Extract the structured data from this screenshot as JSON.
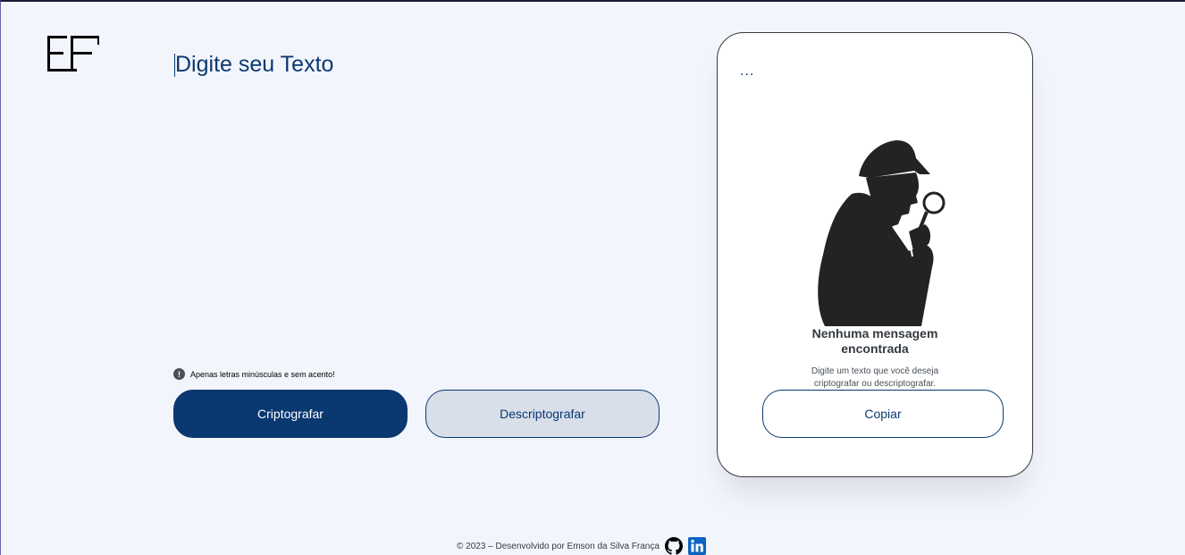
{
  "logo": {
    "alt": "EF"
  },
  "input": {
    "placeholder": "Digite seu Texto",
    "value": ""
  },
  "hint": {
    "icon": "!",
    "text": "Apenas letras minúsculas e sem acento!"
  },
  "buttons": {
    "encrypt": "Criptografar",
    "decrypt": "Descriptografar",
    "copy": "Copiar"
  },
  "output": {
    "dots": "...",
    "title": "Nenhuma mensagem encontrada",
    "description": "Digite um texto que você deseja criptografar ou descriptografar."
  },
  "footer": {
    "text": "© 2023 – Desenvolvido por Emson da Silva França",
    "icons": [
      "github-icon",
      "linkedin-icon"
    ]
  },
  "colors": {
    "background": "#f3f5fc",
    "accent": "#0a3871",
    "secondary": "#d8dfe8",
    "card": "#ffffff",
    "text_dark": "#343a40"
  }
}
